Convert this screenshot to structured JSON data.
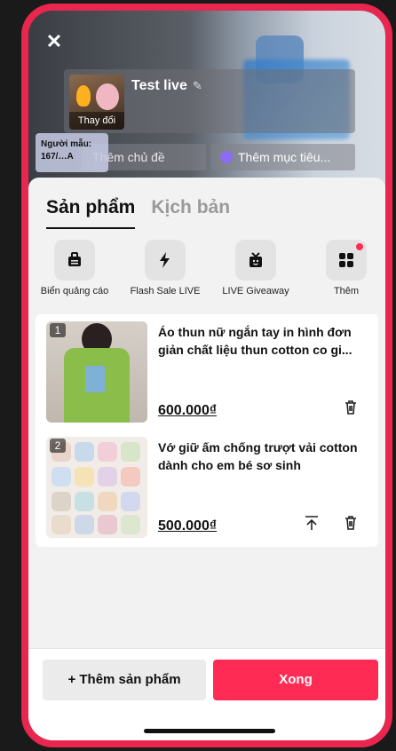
{
  "header": {
    "close_icon": "close-icon",
    "live_title": "Test live",
    "cover_change_label": "Thay đổi",
    "model_tag": "Người mẫu: 167/…A",
    "topic_placeholder": "Thêm chủ đề",
    "goal_label": "Thêm mục tiêu..."
  },
  "tabs": [
    {
      "label": "Sản phẩm",
      "active": true
    },
    {
      "label": "Kịch bản",
      "active": false
    }
  ],
  "actions": [
    {
      "label": "Biển quảng cáo",
      "icon": "billboard-icon"
    },
    {
      "label": "Flash Sale LIVE",
      "icon": "lightning-icon"
    },
    {
      "label": "LIVE Giveaway",
      "icon": "gift-box-icon"
    },
    {
      "label": "Thêm",
      "icon": "apps-grid-icon",
      "badge": true
    }
  ],
  "products": [
    {
      "index": "1",
      "name": "Áo thun nữ ngắn tay in hình đơn giản chất liệu thun cotton co gi...",
      "price": "600.000₫"
    },
    {
      "index": "2",
      "name": "Vớ giữ ấm chống trượt vải cotton dành cho em bé sơ sinh",
      "price": "500.000₫"
    }
  ],
  "footer": {
    "add_label": "+ Thêm sản phẩm",
    "done_label": "Xong"
  },
  "colors": {
    "accent": "#fe2c55",
    "frame": "#e8264e"
  }
}
